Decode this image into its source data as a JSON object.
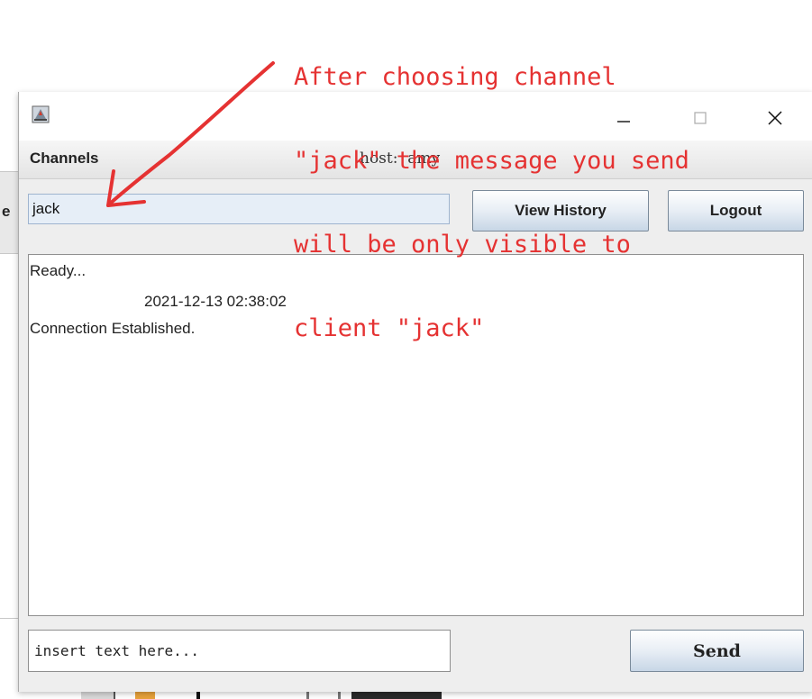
{
  "window": {
    "menu": {
      "channels_label": "Channels"
    },
    "host_label": "host:  amy",
    "channel_field": {
      "value": "jack"
    },
    "buttons": {
      "view_history": "View History",
      "logout": "Logout",
      "send": "Send"
    },
    "log": [
      "Ready...",
      "2021-12-13 02:38:02",
      "Connection Established."
    ],
    "message_input": {
      "placeholder": "insert text here...",
      "value": ""
    },
    "title_controls": [
      "minimize-icon",
      "maximize-icon",
      "close-icon"
    ]
  },
  "background_app": {
    "partial_label": "e"
  },
  "annotation": {
    "lines": [
      "After choosing channel",
      "\"jack\" the message you send",
      "will be only visible to",
      "client \"jack\""
    ],
    "color": "#e53232"
  }
}
